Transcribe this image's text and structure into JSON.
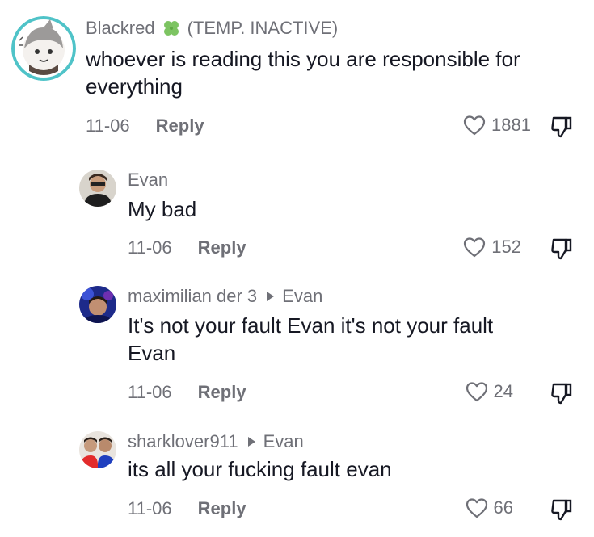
{
  "comments": [
    {
      "username": "Blackred",
      "status_tag": "(TEMP. INACTIVE)",
      "text_line1": "whoever is reading this you are responsible for",
      "text_line2": "everything",
      "date": "11-06",
      "reply_label": "Reply",
      "likes": "1881"
    },
    {
      "username": "Evan",
      "text_line1": "My bad",
      "date": "11-06",
      "reply_label": "Reply",
      "likes": "152"
    },
    {
      "username": "maximilian der 3",
      "reply_to": "Evan",
      "text_line1": "It's not your fault Evan it's not your fault",
      "text_line2": "Evan",
      "date": "11-06",
      "reply_label": "Reply",
      "likes": "24"
    },
    {
      "username": "sharklover911",
      "reply_to": "Evan",
      "text_line1": "its all your fucking fault evan",
      "date": "11-06",
      "reply_label": "Reply",
      "likes": "66"
    }
  ],
  "icons": {
    "like": "heart-outline-icon",
    "dislike": "thumbs-down-icon",
    "badge": "four-leaf-clover-icon",
    "reply_arrow": "triangle-right-icon"
  },
  "colors": {
    "text": "#161823",
    "muted": "#6f7077",
    "clover": "#7dc462",
    "avatar_ring": "#4fc3c8"
  }
}
